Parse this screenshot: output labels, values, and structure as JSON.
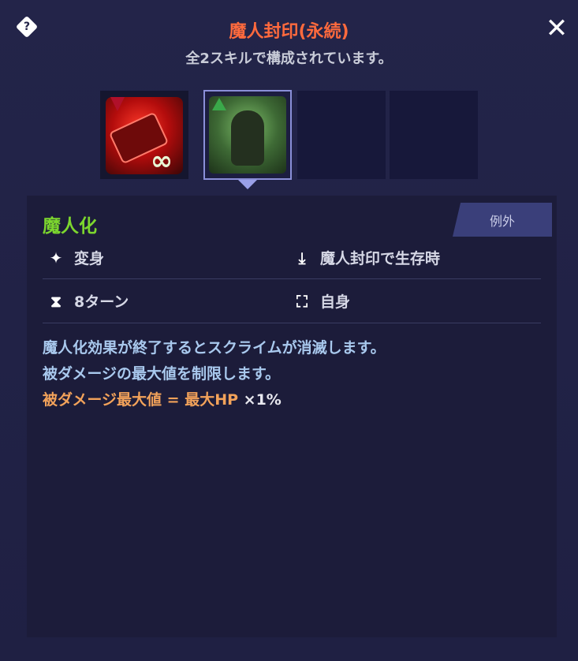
{
  "header": {
    "title": "魔人封印(永続)",
    "subtitle": "全2スキルで構成されています。",
    "help_icon": "question-diamond-icon",
    "close_icon": "close-icon",
    "help_glyph": "?",
    "close_glyph": "✕"
  },
  "skills": {
    "slots": [
      {
        "name": "red-hammer-chain-skill",
        "selected": false,
        "indicator": "down-arrow",
        "badge": "∞"
      },
      {
        "name": "green-demon-skill",
        "selected": true,
        "indicator": "up-arrow"
      },
      {
        "name": "empty-slot"
      },
      {
        "name": "empty-slot"
      }
    ]
  },
  "detail": {
    "tag": "例外",
    "skill_name": "魔人化",
    "effect_type": "変身",
    "condition": "魔人封印で生存時",
    "duration": "8ターン",
    "target": "自身",
    "description": {
      "line1": "魔人化効果が終了するとスクライムが消滅します。",
      "line2": "被ダメージの最大値を制限します。",
      "line3_main": "被ダメージ最大値 = 最大HP ",
      "line3_mult": "×1%"
    },
    "colors": {
      "title": "#ff6a3d",
      "skill_name": "#7cd62e",
      "description": "#a9c9ee",
      "formula": "#f2a25a"
    }
  }
}
